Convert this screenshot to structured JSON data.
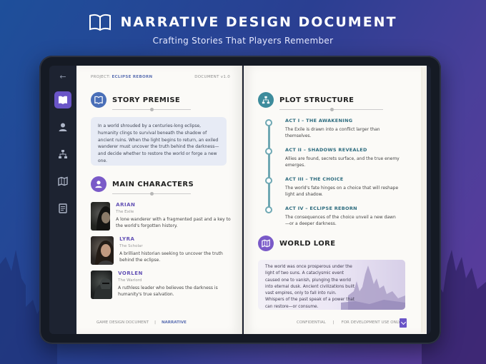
{
  "header": {
    "title": "NARRATIVE DESIGN DOCUMENT",
    "subtitle": "Crafting Stories That Players Remember"
  },
  "left_page": {
    "project_label": "PROJECT:",
    "project_name": "ECLIPSE REBORN",
    "document_version": "DOCUMENT v1.0",
    "premise": {
      "title": "STORY PREMISE",
      "text": "In a world shrouded by a centuries-long eclipse, humanity clings to survival beneath the shadow of ancient ruins. When the light begins to return, an exiled wanderer must uncover the truth behind the darkness—and decide whether to restore the world or forge a new one."
    },
    "characters_title": "MAIN CHARACTERS",
    "characters": [
      {
        "name": "ARIAN",
        "role": "The Exile",
        "desc": "A lone wanderer with a fragmented past and a key to the world's forgotten history."
      },
      {
        "name": "LYRA",
        "role": "The Scholar",
        "desc": "A brilliant historian seeking to uncover the truth behind the eclipse."
      },
      {
        "name": "VORLEN",
        "role": "The Warlord",
        "desc": "A ruthless leader who believes the darkness is humanity's true salvation."
      }
    ],
    "footer_label": "GAME DESIGN DOCUMENT",
    "footer_section": "NARRATIVE"
  },
  "right_page": {
    "plot_title": "PLOT STRUCTURE",
    "acts": [
      {
        "title": "ACT I – THE AWAKENING",
        "desc": "The Exile is drawn into a conflict larger than themselves."
      },
      {
        "title": "ACT II – SHADOWS REVEALED",
        "desc": "Allies are found, secrets surface, and the true enemy emerges."
      },
      {
        "title": "ACT III – THE CHOICE",
        "desc": "The world's fate hinges on a choice that will reshape light and shadow."
      },
      {
        "title": "ACT IV – ECLIPSE REBORN",
        "desc": "The consequences of the choice unveil a new dawn—or a deeper darkness."
      }
    ],
    "lore_title": "WORLD LORE",
    "lore_text": "The world was once prosperous under the light of two suns. A cataclysmic event caused one to vanish, plunging the world into eternal dusk. Ancient civilizations built vast empires, only to fall into ruin. Whispers of the past speak of a power that can restore—or consume.",
    "footer_confidential": "CONFIDENTIAL",
    "footer_use": "FOR DEVELOPMENT USE ONLY"
  },
  "colors": {
    "accent_purple": "#6a55c7",
    "accent_blue": "#4a6fb8",
    "accent_teal": "#3d8c9c"
  },
  "sidebar_icons": [
    "book-icon",
    "user-icon",
    "hierarchy-icon",
    "map-icon",
    "notes-icon"
  ]
}
